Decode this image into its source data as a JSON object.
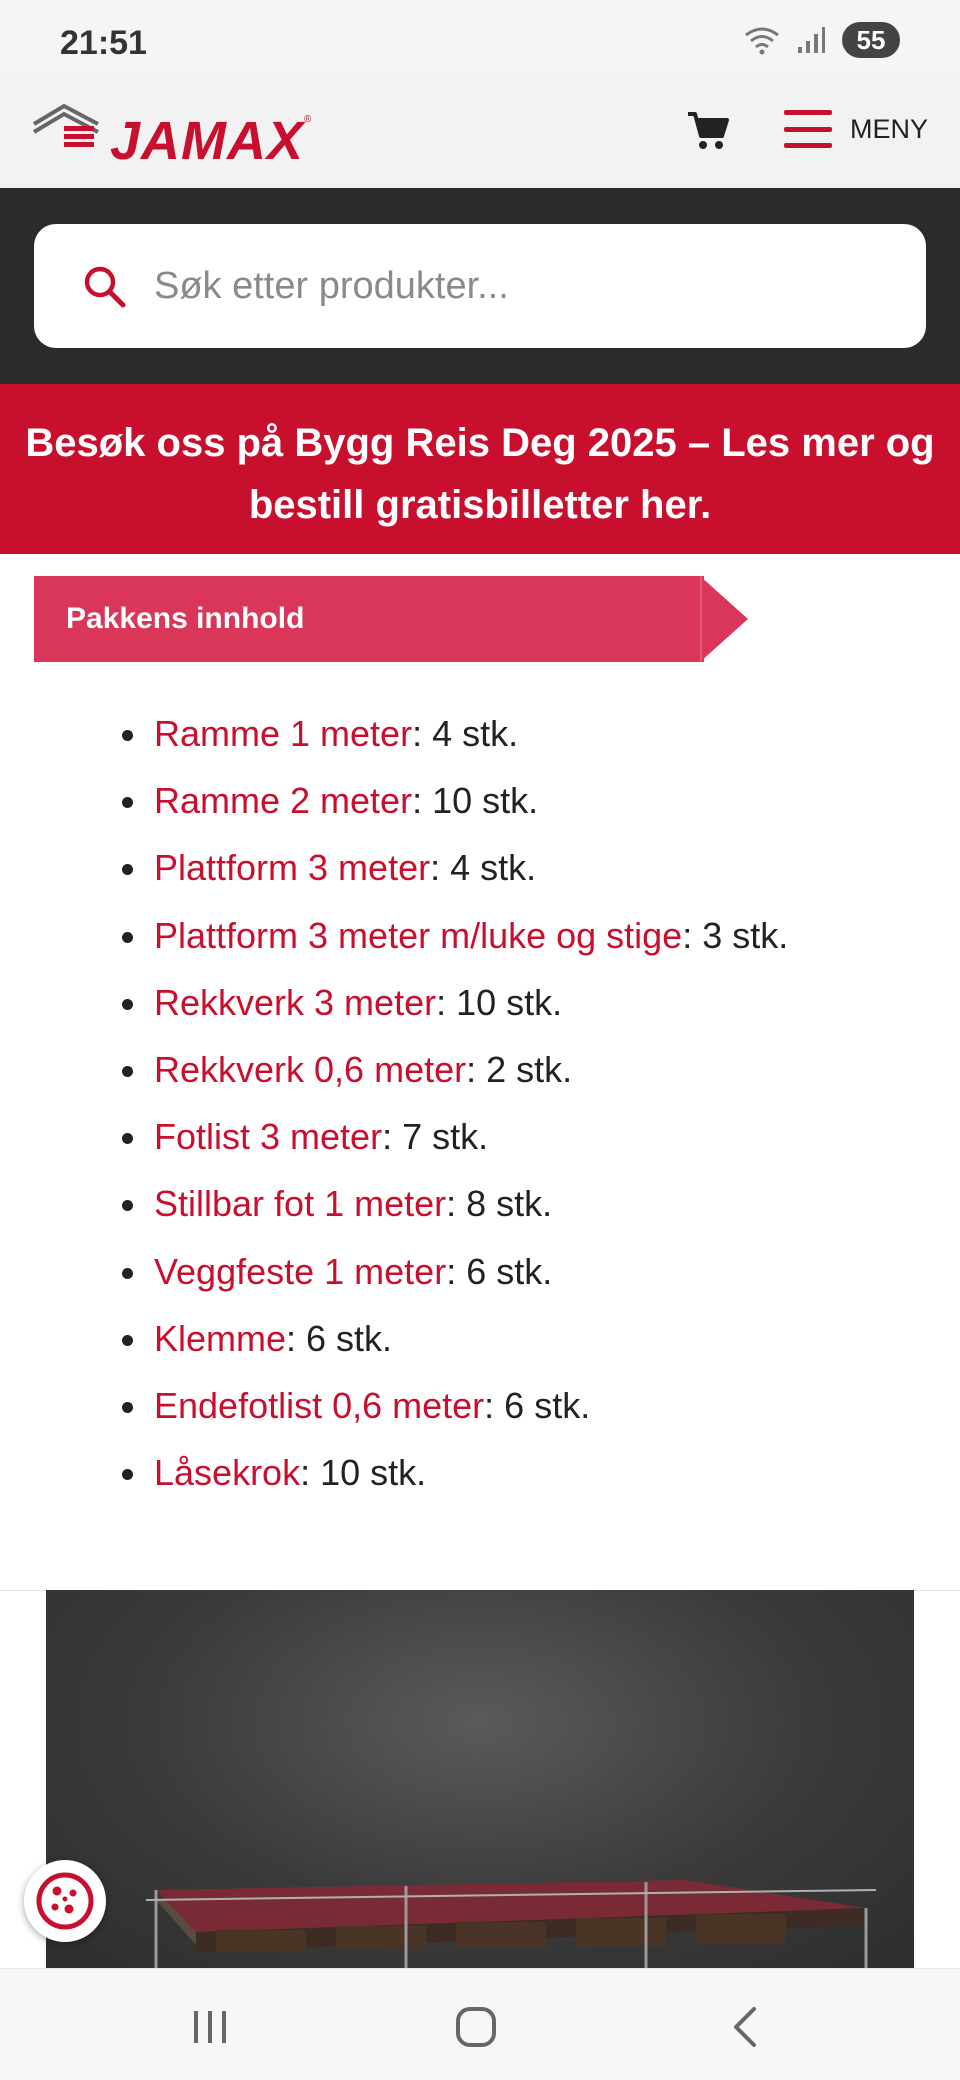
{
  "status_bar": {
    "time": "21:51",
    "battery": "55",
    "icons": [
      "wifi-icon",
      "signal-icon",
      "battery-icon"
    ]
  },
  "header": {
    "logo_text": "JAMAX",
    "logo_reg": "®",
    "menu_label": "MENY",
    "icons": [
      "cart-icon",
      "hamburger-icon"
    ]
  },
  "search": {
    "placeholder": "Søk etter produkter..."
  },
  "promo": {
    "text": "Besøk oss på Bygg Reis Deg 2025 – Les mer og bestill gratisbilletter her."
  },
  "section": {
    "title": "Pakkens innhold"
  },
  "contents": [
    {
      "name": "Ramme 1 meter",
      "qty": ": 4 stk."
    },
    {
      "name": "Ramme 2 meter",
      "qty": ": 10 stk."
    },
    {
      "name": "Plattform 3 meter",
      "qty": ": 4 stk."
    },
    {
      "name": "Plattform 3 meter m/luke og stige",
      "qty": ": 3 stk."
    },
    {
      "name": "Rekkverk 3 meter",
      "qty": ": 10 stk."
    },
    {
      "name": "Rekkverk 0,6 meter",
      "qty": ": 2 stk."
    },
    {
      "name": "Fotlist 3 meter",
      "qty": ": 7 stk."
    },
    {
      "name": "Stillbar fot 1 meter",
      "qty": ": 8 stk."
    },
    {
      "name": "Veggfeste 1 meter",
      "qty": ": 6 stk."
    },
    {
      "name": "Klemme",
      "qty": ": 6 stk."
    },
    {
      "name": "Endefotlist 0,6 meter",
      "qty": ": 6 stk."
    },
    {
      "name": "Låsekrok",
      "qty": ": 10 stk."
    }
  ],
  "colors": {
    "brand_red": "#c8102e",
    "section_pink": "#d9365a",
    "dark_band": "#2b2b2b"
  },
  "nav": {
    "icons": [
      "recent-apps-icon",
      "home-icon",
      "back-icon"
    ]
  }
}
